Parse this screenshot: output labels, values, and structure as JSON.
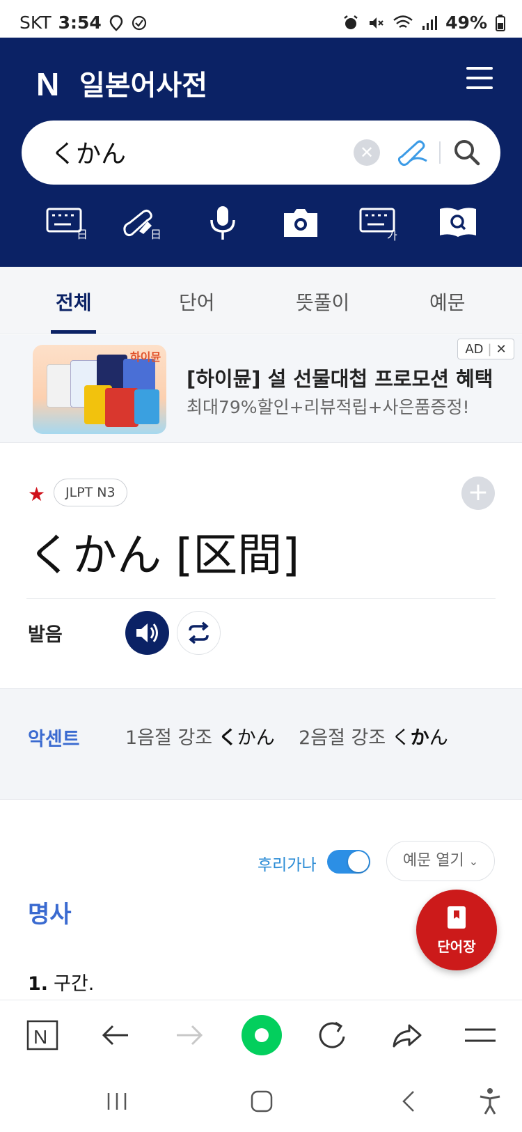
{
  "status_bar": {
    "carrier": "SKT",
    "time": "3:54",
    "battery": "49%"
  },
  "header": {
    "logo": "N",
    "title": "일본어사전"
  },
  "search": {
    "query": "くかん"
  },
  "tabs": [
    "전체",
    "단어",
    "뜻풀이",
    "예문"
  ],
  "ad": {
    "badge": "AD",
    "image_brand": "하이뮨",
    "title": "[하이뮨] 설 선물대첩 프로모션 혜택",
    "subtitle": "최대79%할인+리뷰적립+사은품증정!"
  },
  "entry": {
    "level": "JLPT N3",
    "headword": "くかん [区間]",
    "pronunciation_label": "발음"
  },
  "accent": {
    "label": "악센트",
    "item1_label": "1음절 강조",
    "item1_kana_bold": "く",
    "item1_kana_rest": "かん",
    "item2_label": "2음절 강조",
    "item2_kana_first": "く",
    "item2_kana_bold": "か",
    "item2_kana_rest": "ん"
  },
  "definition": {
    "furigana_label": "후리가나",
    "furigana_on": true,
    "examples_button": "예문 열기",
    "part_of_speech": "명사",
    "senses": [
      {
        "num": "1.",
        "text": "구간."
      }
    ]
  },
  "wordbook_button": "단어장",
  "colors": {
    "brand_navy": "#0b2265",
    "accent_blue": "#3a6ad0",
    "wordbook_red": "#cc1a1a",
    "toggle_blue": "#2c8fe5",
    "naver_green": "#03cf5d"
  }
}
